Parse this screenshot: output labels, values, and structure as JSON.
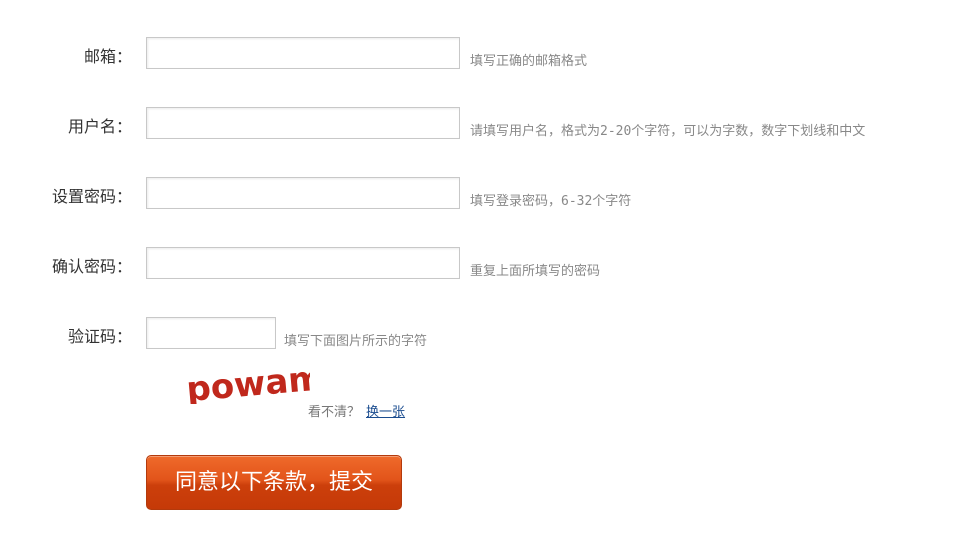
{
  "form": {
    "fields": [
      {
        "label": "邮箱：",
        "value": "",
        "hint": "填写正确的邮箱格式"
      },
      {
        "label": "用户名：",
        "value": "",
        "hint": "请填写用户名，格式为2-20个字符，可以为字数，数字下划线和中文"
      },
      {
        "label": "设置密码：",
        "value": "",
        "hint": "填写登录密码，6-32个字符"
      },
      {
        "label": "确认密码：",
        "value": "",
        "hint": "重复上面所填写的密码"
      },
      {
        "label": "验证码：",
        "value": "",
        "hint": "填写下面图片所示的字符"
      }
    ],
    "captcha": {
      "text": "powam",
      "tip": "看不清？",
      "refresh_label": "换一张"
    },
    "submit_label": "同意以下条款，提交"
  },
  "colors": {
    "button": "#e2541a",
    "link": "#1a4c8f",
    "captcha_text": "#c0281c"
  }
}
